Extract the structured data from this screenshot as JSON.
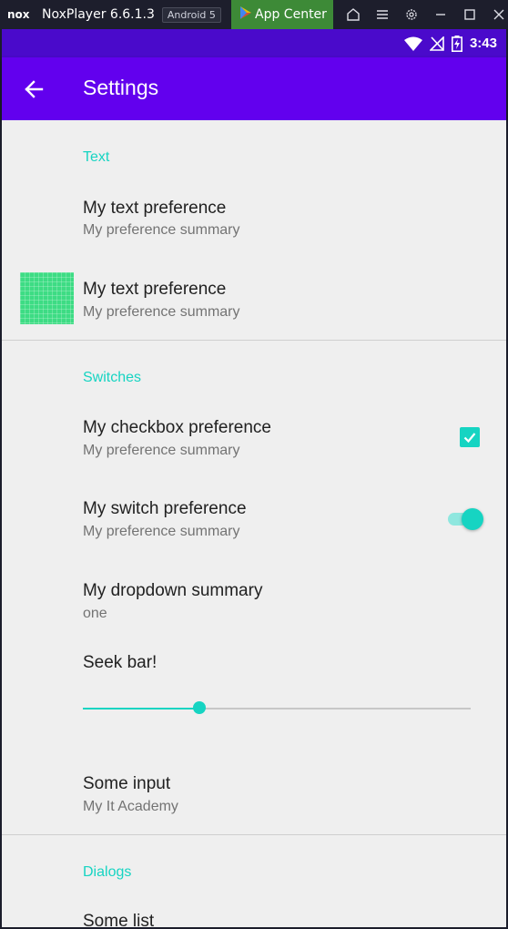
{
  "emulator": {
    "logo": "nox",
    "title": "NoxPlayer 6.6.1.3",
    "badge": "Android 5",
    "app_center": "App Center",
    "icons": [
      "home-outline-icon",
      "menu-icon",
      "gear-icon",
      "minimize-icon",
      "maximize-icon",
      "close-icon"
    ]
  },
  "status_bar": {
    "time": "3:43",
    "icons": [
      "wifi-icon",
      "no-signal-icon",
      "battery-charging-icon"
    ]
  },
  "app_bar": {
    "title": "Settings",
    "back_icon": "arrow-back-icon"
  },
  "settings": {
    "categories": {
      "text": "Text",
      "switches": "Switches",
      "dialogs": "Dialogs"
    },
    "text_pref_1": {
      "title": "My text preference",
      "summary": "My preference summary"
    },
    "text_pref_2": {
      "title": "My text preference",
      "summary": "My preference summary",
      "icon": "app-launcher-icon"
    },
    "checkbox_pref": {
      "title": "My checkbox preference",
      "summary": "My preference summary",
      "checked": true
    },
    "switch_pref": {
      "title": "My switch preference",
      "summary": "My preference summary",
      "on": true
    },
    "dropdown_pref": {
      "title": "My dropdown summary",
      "summary": "one"
    },
    "seek_bar": {
      "title": "Seek bar!",
      "value": 0.3
    },
    "input_pref": {
      "title": "Some input",
      "summary": "My It Academy"
    },
    "list_pref": {
      "title": "Some list"
    }
  },
  "colors": {
    "accent": "#16d4c2",
    "primary": "#6200ee",
    "primary_dark": "#4a0acb",
    "background": "#efefef"
  }
}
